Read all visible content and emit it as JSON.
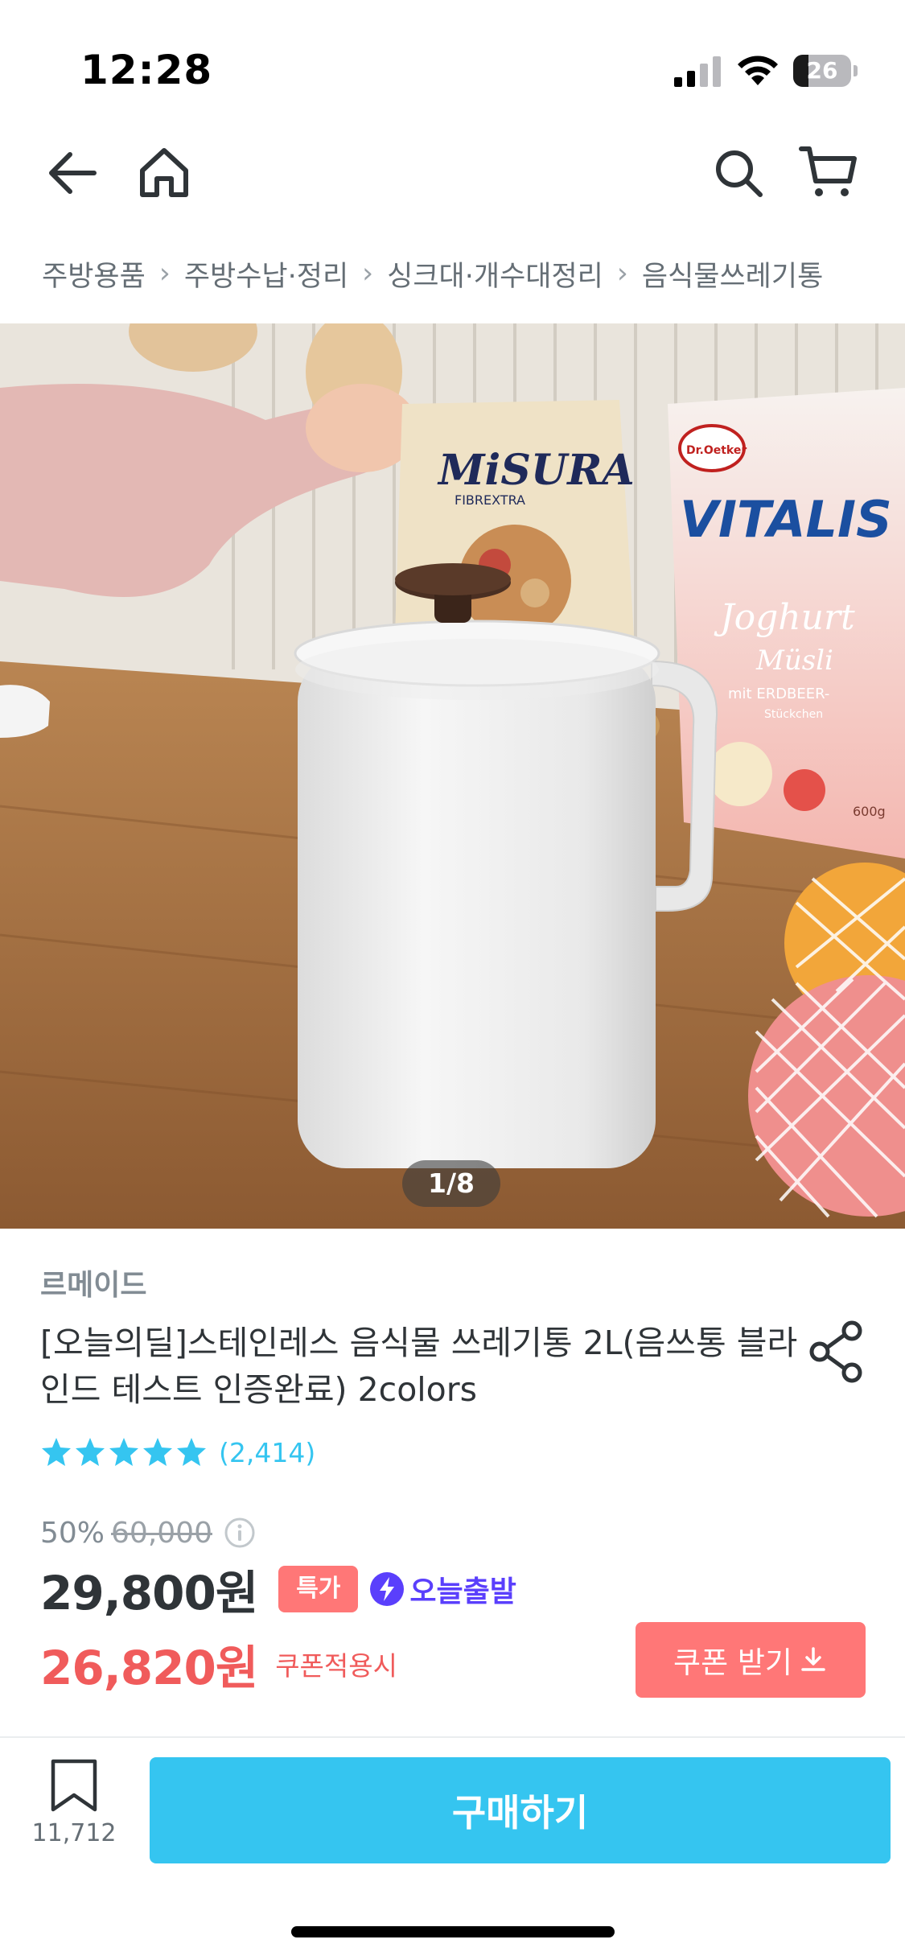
{
  "status_bar": {
    "time": "12:28",
    "battery": "26",
    "battery_level": 0.26,
    "icons": [
      "signal-icon",
      "wifi-icon",
      "battery-icon"
    ]
  },
  "nav": {
    "icons": [
      "back-arrow-icon",
      "home-icon",
      "search-icon",
      "cart-icon"
    ]
  },
  "breadcrumb": [
    "주방용품",
    "주방수납·정리",
    "싱크대·개수대정리",
    "음식물쓰레기통"
  ],
  "gallery": {
    "pager": "1/8",
    "image_labels": {
      "bag_brand": "MiSURA",
      "bag_sub": "FIBREXTRA",
      "box_maker": "Dr.Oetker",
      "box_brand": "VITALIS",
      "box_line1": "Joghurt",
      "box_line2": "Müsli",
      "box_line3": "mit ERDBEER-",
      "box_line4": "Stückchen",
      "box_weight": "600g"
    }
  },
  "product": {
    "brand": "르메이드",
    "title": "[오늘의딜]스테인레스 음식물 쓰레기통 2L(음쓰통 블라인드 테스트 인증완료) 2colors",
    "rating_stars": 5,
    "review_count": "(2,414)",
    "discount_rate": "50%",
    "original_price": "60,000",
    "sale_price": "29,800원",
    "badge_special": "특가",
    "badge_delivery": "오늘출발",
    "coupon_price": "26,820원",
    "coupon_note": "쿠폰적용시",
    "coupon_button": "쿠폰 받기"
  },
  "bottom_bar": {
    "bookmark_count": "11,712",
    "buy_button": "구매하기"
  },
  "colors": {
    "accent": "#35c5f0",
    "coupon": "#f05b5b",
    "badge": "#ff7777",
    "delivery": "#5a3ffc"
  }
}
